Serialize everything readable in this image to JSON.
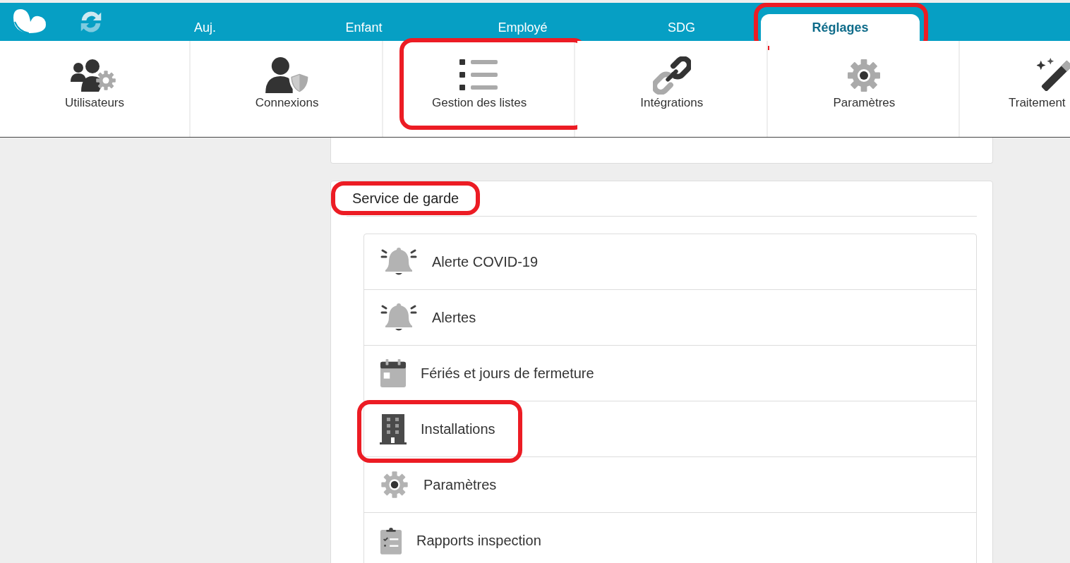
{
  "tabs": [
    {
      "label": "Auj.",
      "selected": false,
      "highlighted": false
    },
    {
      "label": "Enfant",
      "selected": false,
      "highlighted": false
    },
    {
      "label": "Employé",
      "selected": false,
      "highlighted": false
    },
    {
      "label": "SDG",
      "selected": false,
      "highlighted": false
    },
    {
      "label": "Réglages",
      "selected": true,
      "highlighted": true
    }
  ],
  "tools": [
    {
      "label": "Utilisateurs",
      "kind": "users",
      "highlighted": false
    },
    {
      "label": "Connexions",
      "kind": "shield",
      "highlighted": false
    },
    {
      "label": "Gestion des listes",
      "kind": "list",
      "highlighted": true
    },
    {
      "label": "Intégrations",
      "kind": "link",
      "highlighted": false
    },
    {
      "label": "Paramètres",
      "kind": "gear",
      "highlighted": false
    },
    {
      "label": "Traitement",
      "kind": "wand",
      "highlighted": false
    }
  ],
  "section": {
    "title": "Service de garde",
    "highlighted": true,
    "items": [
      {
        "label": "Alerte COVID-19",
        "kind": "bell",
        "highlighted": false
      },
      {
        "label": "Alertes",
        "kind": "bell",
        "highlighted": false
      },
      {
        "label": "Fériés et jours de fermeture",
        "kind": "calendar",
        "highlighted": false
      },
      {
        "label": "Installations",
        "kind": "building",
        "highlighted": true
      },
      {
        "label": "Paramètres",
        "kind": "gear",
        "highlighted": false
      },
      {
        "label": "Rapports inspection",
        "kind": "clipboard",
        "highlighted": false
      }
    ]
  }
}
